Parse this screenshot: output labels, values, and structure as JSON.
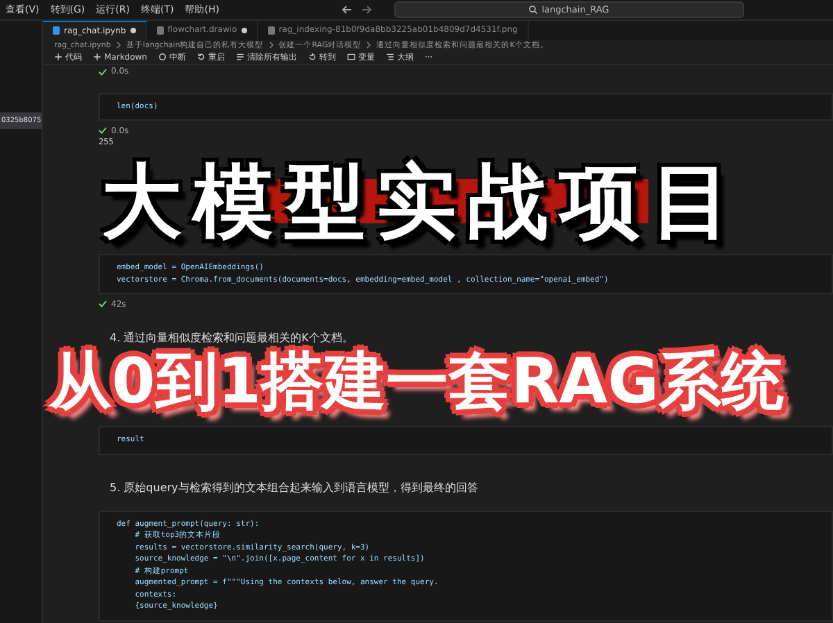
{
  "menu": [
    "查看(V)",
    "转到(G)",
    "运行(R)",
    "终端(T)",
    "帮助(H)"
  ],
  "search": {
    "value": "langchain_RAG"
  },
  "sidebar": {
    "items": [
      {
        "label": "0325b8075",
        "selected": true
      }
    ]
  },
  "tabs": [
    {
      "label": "rag_chat.ipynb",
      "selected": true,
      "modified": true
    },
    {
      "label": "flowchart.drawio",
      "selected": false,
      "modified": true
    },
    {
      "label": "rag_indexing-81b0f9da8bb3225ab01b4809d7d4531f.png",
      "selected": false,
      "modified": false
    }
  ],
  "breadcrumb": [
    "rag_chat.ipynb",
    "基于langchain构建自己的私有大模型",
    "创建一个RAG对话模型",
    "通过向量相似度检索和问题最相关的K个文档。"
  ],
  "toolbar": [
    {
      "kind": "add",
      "label": "代码"
    },
    {
      "kind": "add",
      "label": "Markdown"
    },
    {
      "kind": "stop",
      "label": "中断"
    },
    {
      "kind": "restart",
      "label": "重启"
    },
    {
      "kind": "clear",
      "label": "清除所有输出"
    },
    {
      "kind": "goto",
      "label": "转到"
    },
    {
      "kind": "vars",
      "label": "变量"
    },
    {
      "kind": "outline",
      "label": "大纲"
    },
    {
      "kind": "more",
      "label": "···"
    }
  ],
  "cells": [
    {
      "kind": "status",
      "text": "0.0s"
    },
    {
      "kind": "code",
      "lines": [
        "len(docs)"
      ]
    },
    {
      "kind": "status",
      "text": "0.0s"
    },
    {
      "kind": "output",
      "text": "255"
    },
    {
      "kind": "code",
      "lines": [
        "embed_model = OpenAIEmbeddings()",
        "vectorstore = Chroma.from_documents(documents=docs, embedding=embed_model , collection_name=\"openai_embed\")"
      ]
    },
    {
      "kind": "status",
      "text": "42s"
    },
    {
      "kind": "markdown",
      "text": "4. 通过向量相似度检索和问题最相关的K个文档。"
    },
    {
      "kind": "code",
      "lines": [
        "result"
      ]
    },
    {
      "kind": "markdown",
      "text": "5. 原始query与检索得到的文本组合起来输入到语言模型，得到最终的回答"
    },
    {
      "kind": "code",
      "lines": [
        "def augment_prompt(query: str):",
        "    # 获取top3的文本片段",
        "    results = vectorstore.similarity_search(query, k=3)",
        "    source_knowledge = \"\\n\".join([x.page_content for x in results])",
        "    # 构建prompt",
        "    augmented_prompt = f\"\"\"Using the contexts below, answer the query.",
        "    contexts:",
        "    {source_knowledge}"
      ]
    }
  ],
  "overlay": {
    "title": "大模型实战项目",
    "subtitle": "从0到1搭建一套RAG系统"
  }
}
